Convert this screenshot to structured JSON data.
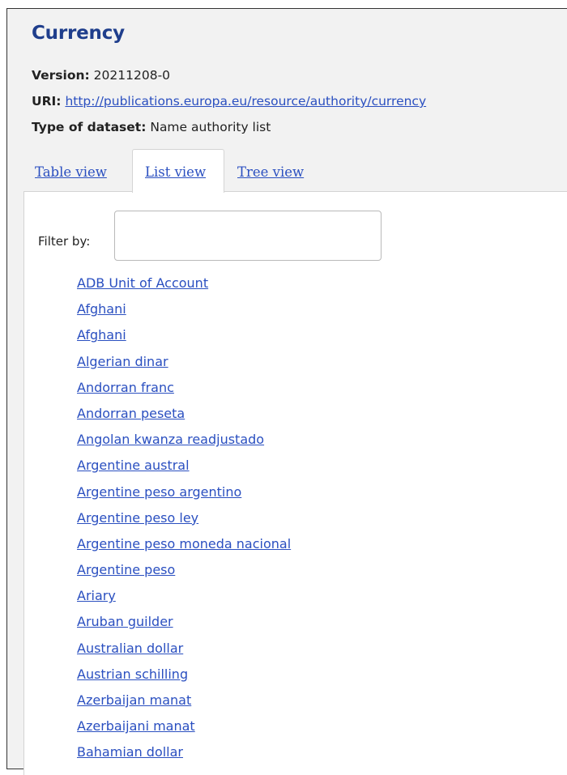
{
  "page": {
    "title": "Currency"
  },
  "meta": {
    "version_label": "Version:",
    "version_value": "20211208-0",
    "uri_label": "URI:",
    "uri_value": "http://publications.europa.eu/resource/authority/currency",
    "type_label": "Type of dataset:",
    "type_value": "Name authority list"
  },
  "tabs": [
    {
      "label": "Table view",
      "active": false
    },
    {
      "label": "List view",
      "active": true
    },
    {
      "label": "Tree view",
      "active": false
    }
  ],
  "filter": {
    "label": "Filter by:",
    "value": "",
    "placeholder": ""
  },
  "currencies": [
    "ADB Unit of Account",
    "Afghani",
    "Afghani",
    "Algerian dinar",
    "Andorran franc",
    "Andorran peseta",
    "Angolan kwanza readjustado",
    "Argentine austral",
    "Argentine peso argentino",
    "Argentine peso ley",
    "Argentine peso moneda nacional",
    "Argentine peso",
    "Ariary",
    "Aruban guilder",
    "Australian dollar",
    "Austrian schilling",
    "Azerbaijan manat",
    "Azerbaijani manat",
    "Bahamian dollar"
  ],
  "colors": {
    "title": "#1f3e8c",
    "link": "#2a4fc0",
    "header_bg": "#f2f2f2",
    "panel_bg": "#ffffff"
  }
}
